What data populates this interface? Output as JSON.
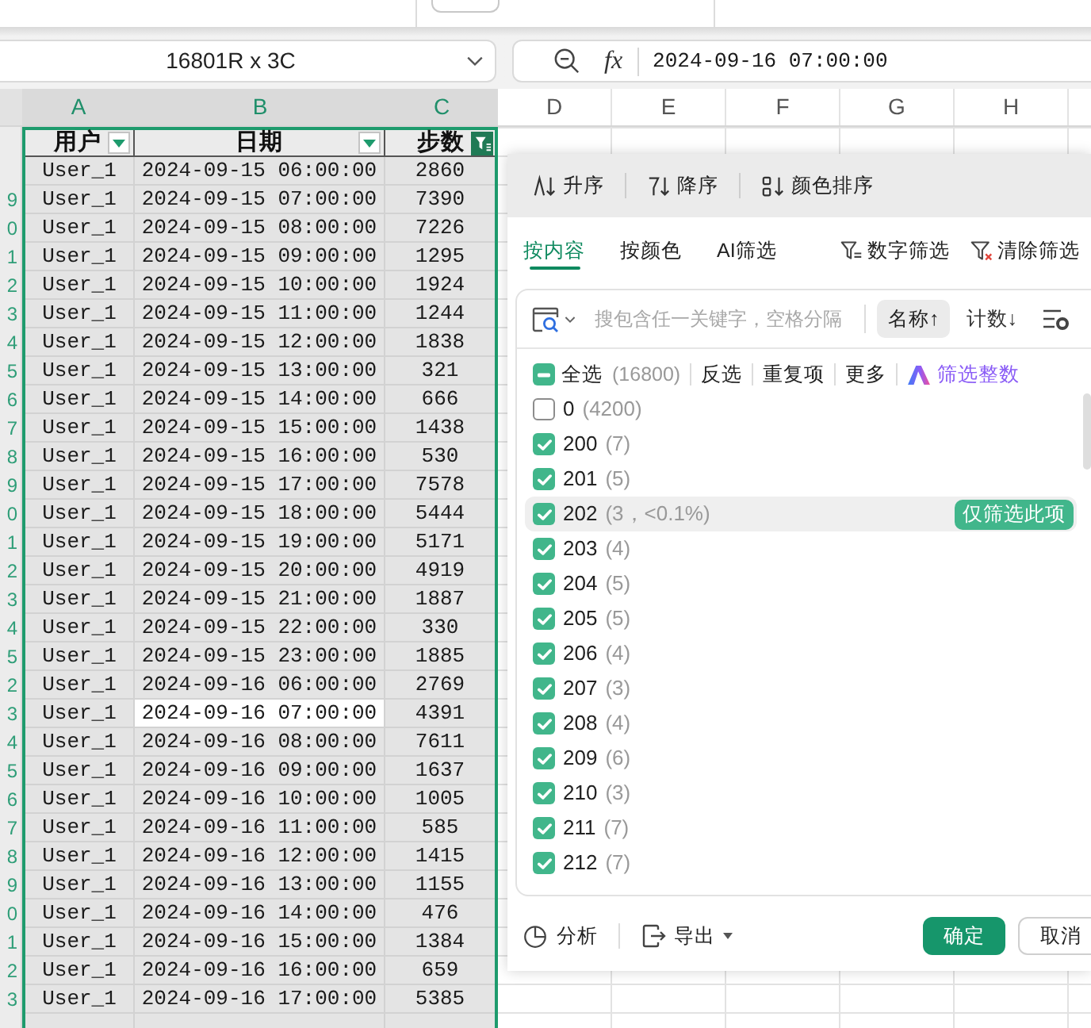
{
  "toolbar": {
    "name_box": "16801R x 3C",
    "formula_label": "fx",
    "formula_value": "2024-09-16 07:00:00"
  },
  "columns": [
    {
      "label": "A",
      "selected": true
    },
    {
      "label": "B",
      "selected": true
    },
    {
      "label": "C",
      "selected": true
    },
    {
      "label": "D",
      "selected": false
    },
    {
      "label": "E",
      "selected": false
    },
    {
      "label": "F",
      "selected": false
    },
    {
      "label": "G",
      "selected": false
    },
    {
      "label": "H",
      "selected": false
    }
  ],
  "header_row": [
    {
      "label": "用户",
      "filter_applied": false
    },
    {
      "label": "日期",
      "filter_applied": false
    },
    {
      "label": "步数",
      "filter_applied": true
    }
  ],
  "rows": [
    {
      "cells": [
        {
          "text": "User_1",
          "active": false
        },
        {
          "text": "2024-09-15 06:00:00",
          "active": false
        },
        {
          "text": "2860",
          "active": false
        }
      ]
    },
    {
      "row_label": "9",
      "cells": [
        {
          "text": "User_1",
          "active": false
        },
        {
          "text": "2024-09-15 07:00:00",
          "active": false
        },
        {
          "text": "7390",
          "active": false
        }
      ]
    },
    {
      "row_label": "0",
      "cells": [
        {
          "text": "User_1",
          "active": false
        },
        {
          "text": "2024-09-15 08:00:00",
          "active": false
        },
        {
          "text": "7226",
          "active": false
        }
      ]
    },
    {
      "row_label": "1",
      "cells": [
        {
          "text": "User_1",
          "active": false
        },
        {
          "text": "2024-09-15 09:00:00",
          "active": false
        },
        {
          "text": "1295",
          "active": false
        }
      ]
    },
    {
      "row_label": "2",
      "cells": [
        {
          "text": "User_1",
          "active": false
        },
        {
          "text": "2024-09-15 10:00:00",
          "active": false
        },
        {
          "text": "1924",
          "active": false
        }
      ]
    },
    {
      "row_label": "3",
      "cells": [
        {
          "text": "User_1",
          "active": false
        },
        {
          "text": "2024-09-15 11:00:00",
          "active": false
        },
        {
          "text": "1244",
          "active": false
        }
      ]
    },
    {
      "row_label": "4",
      "cells": [
        {
          "text": "User_1",
          "active": false
        },
        {
          "text": "2024-09-15 12:00:00",
          "active": false
        },
        {
          "text": "1838",
          "active": false
        }
      ]
    },
    {
      "row_label": "5",
      "cells": [
        {
          "text": "User_1",
          "active": false
        },
        {
          "text": "2024-09-15 13:00:00",
          "active": false
        },
        {
          "text": "321",
          "active": false
        }
      ]
    },
    {
      "row_label": "6",
      "cells": [
        {
          "text": "User_1",
          "active": false
        },
        {
          "text": "2024-09-15 14:00:00",
          "active": false
        },
        {
          "text": "666",
          "active": false
        }
      ]
    },
    {
      "row_label": "7",
      "cells": [
        {
          "text": "User_1",
          "active": false
        },
        {
          "text": "2024-09-15 15:00:00",
          "active": false
        },
        {
          "text": "1438",
          "active": false
        }
      ]
    },
    {
      "row_label": "8",
      "cells": [
        {
          "text": "User_1",
          "active": false
        },
        {
          "text": "2024-09-15 16:00:00",
          "active": false
        },
        {
          "text": "530",
          "active": false
        }
      ]
    },
    {
      "row_label": "9",
      "cells": [
        {
          "text": "User_1",
          "active": false
        },
        {
          "text": "2024-09-15 17:00:00",
          "active": false
        },
        {
          "text": "7578",
          "active": false
        }
      ]
    },
    {
      "row_label": "0",
      "cells": [
        {
          "text": "User_1",
          "active": false
        },
        {
          "text": "2024-09-15 18:00:00",
          "active": false
        },
        {
          "text": "5444",
          "active": false
        }
      ]
    },
    {
      "row_label": "1",
      "cells": [
        {
          "text": "User_1",
          "active": false
        },
        {
          "text": "2024-09-15 19:00:00",
          "active": false
        },
        {
          "text": "5171",
          "active": false
        }
      ]
    },
    {
      "row_label": "2",
      "cells": [
        {
          "text": "User_1",
          "active": false
        },
        {
          "text": "2024-09-15 20:00:00",
          "active": false
        },
        {
          "text": "4919",
          "active": false
        }
      ]
    },
    {
      "row_label": "3",
      "cells": [
        {
          "text": "User_1",
          "active": false
        },
        {
          "text": "2024-09-15 21:00:00",
          "active": false
        },
        {
          "text": "1887",
          "active": false
        }
      ]
    },
    {
      "row_label": "4",
      "cells": [
        {
          "text": "User_1",
          "active": false
        },
        {
          "text": "2024-09-15 22:00:00",
          "active": false
        },
        {
          "text": "330",
          "active": false
        }
      ]
    },
    {
      "row_label": "5",
      "cells": [
        {
          "text": "User_1",
          "active": false
        },
        {
          "text": "2024-09-15 23:00:00",
          "active": false
        },
        {
          "text": "1885",
          "active": false
        }
      ]
    },
    {
      "row_label": "2",
      "cells": [
        {
          "text": "User_1",
          "active": false
        },
        {
          "text": "2024-09-16 06:00:00",
          "active": false
        },
        {
          "text": "2769",
          "active": false
        }
      ]
    },
    {
      "row_label": "3",
      "cells": [
        {
          "text": "User_1",
          "active": false
        },
        {
          "text": "2024-09-16 07:00:00",
          "active": true
        },
        {
          "text": "4391",
          "active": false
        }
      ]
    },
    {
      "row_label": "4",
      "cells": [
        {
          "text": "User_1",
          "active": false
        },
        {
          "text": "2024-09-16 08:00:00",
          "active": false
        },
        {
          "text": "7611",
          "active": false
        }
      ]
    },
    {
      "row_label": "5",
      "cells": [
        {
          "text": "User_1",
          "active": false
        },
        {
          "text": "2024-09-16 09:00:00",
          "active": false
        },
        {
          "text": "1637",
          "active": false
        }
      ]
    },
    {
      "row_label": "6",
      "cells": [
        {
          "text": "User_1",
          "active": false
        },
        {
          "text": "2024-09-16 10:00:00",
          "active": false
        },
        {
          "text": "1005",
          "active": false
        }
      ]
    },
    {
      "row_label": "7",
      "cells": [
        {
          "text": "User_1",
          "active": false
        },
        {
          "text": "2024-09-16 11:00:00",
          "active": false
        },
        {
          "text": "585",
          "active": false
        }
      ]
    },
    {
      "row_label": "8",
      "cells": [
        {
          "text": "User_1",
          "active": false
        },
        {
          "text": "2024-09-16 12:00:00",
          "active": false
        },
        {
          "text": "1415",
          "active": false
        }
      ]
    },
    {
      "row_label": "9",
      "cells": [
        {
          "text": "User_1",
          "active": false
        },
        {
          "text": "2024-09-16 13:00:00",
          "active": false
        },
        {
          "text": "1155",
          "active": false
        }
      ]
    },
    {
      "row_label": "0",
      "cells": [
        {
          "text": "User_1",
          "active": false
        },
        {
          "text": "2024-09-16 14:00:00",
          "active": false
        },
        {
          "text": "476",
          "active": false
        }
      ]
    },
    {
      "row_label": "1",
      "cells": [
        {
          "text": "User_1",
          "active": false
        },
        {
          "text": "2024-09-16 15:00:00",
          "active": false
        },
        {
          "text": "1384",
          "active": false
        }
      ]
    },
    {
      "row_label": "2",
      "cells": [
        {
          "text": "User_1",
          "active": false
        },
        {
          "text": "2024-09-16 16:00:00",
          "active": false
        },
        {
          "text": "659",
          "active": false
        }
      ]
    },
    {
      "row_label": "3",
      "cells": [
        {
          "text": "User_1",
          "active": false
        },
        {
          "text": "2024-09-16 17:00:00",
          "active": false
        },
        {
          "text": "5385",
          "active": false
        }
      ]
    },
    {
      "cells": [
        {
          "active": false
        },
        {
          "active": false
        },
        {
          "active": false
        }
      ]
    }
  ],
  "filter_panel": {
    "sort_buttons": [
      {
        "kind": "ascending",
        "label": "升序"
      },
      {
        "kind": "descending",
        "label": "降序"
      },
      {
        "kind": "color",
        "label": "颜色排序"
      }
    ],
    "tabs": [
      {
        "label": "按内容",
        "selected": true
      },
      {
        "label": "按颜色",
        "selected": false
      },
      {
        "label": "AI筛选",
        "selected": false
      }
    ],
    "tools": [
      {
        "kind": "number_filter",
        "label": "数字筛选"
      },
      {
        "kind": "clear_filter",
        "label": "清除筛选"
      }
    ],
    "search": {
      "placeholder": "搜包含任一关键字，空格分隔"
    },
    "sort_options": [
      {
        "label": "名称↑",
        "selected": true
      },
      {
        "label": "计数↓",
        "selected": false
      }
    ],
    "select_all": {
      "label": "全选",
      "count": "(16800)",
      "indeterminate": true
    },
    "links": [
      "反选",
      "重复项",
      "更多"
    ],
    "ai_link": "筛选整数",
    "only_button": "仅筛选此项",
    "items": [
      {
        "value": "0",
        "count": "(4200)",
        "checked": false,
        "hovered": false
      },
      {
        "value": "200",
        "count": "(7)",
        "checked": true,
        "hovered": false
      },
      {
        "value": "201",
        "count": "(5)",
        "checked": true,
        "hovered": false
      },
      {
        "value": "202",
        "count": "(3，<0.1%)",
        "checked": true,
        "hovered": true
      },
      {
        "value": "203",
        "count": "(4)",
        "checked": true,
        "hovered": false
      },
      {
        "value": "204",
        "count": "(5)",
        "checked": true,
        "hovered": false
      },
      {
        "value": "205",
        "count": "(5)",
        "checked": true,
        "hovered": false
      },
      {
        "value": "206",
        "count": "(4)",
        "checked": true,
        "hovered": false
      },
      {
        "value": "207",
        "count": "(3)",
        "checked": true,
        "hovered": false
      },
      {
        "value": "208",
        "count": "(4)",
        "checked": true,
        "hovered": false
      },
      {
        "value": "209",
        "count": "(6)",
        "checked": true,
        "hovered": false
      },
      {
        "value": "210",
        "count": "(3)",
        "checked": true,
        "hovered": false
      },
      {
        "value": "211",
        "count": "(7)",
        "checked": true,
        "hovered": false
      },
      {
        "value": "212",
        "count": "(7)",
        "checked": true,
        "hovered": false
      }
    ],
    "footer": {
      "analyze": "分析",
      "export": "导出",
      "confirm": "确定",
      "cancel": "取消"
    }
  }
}
